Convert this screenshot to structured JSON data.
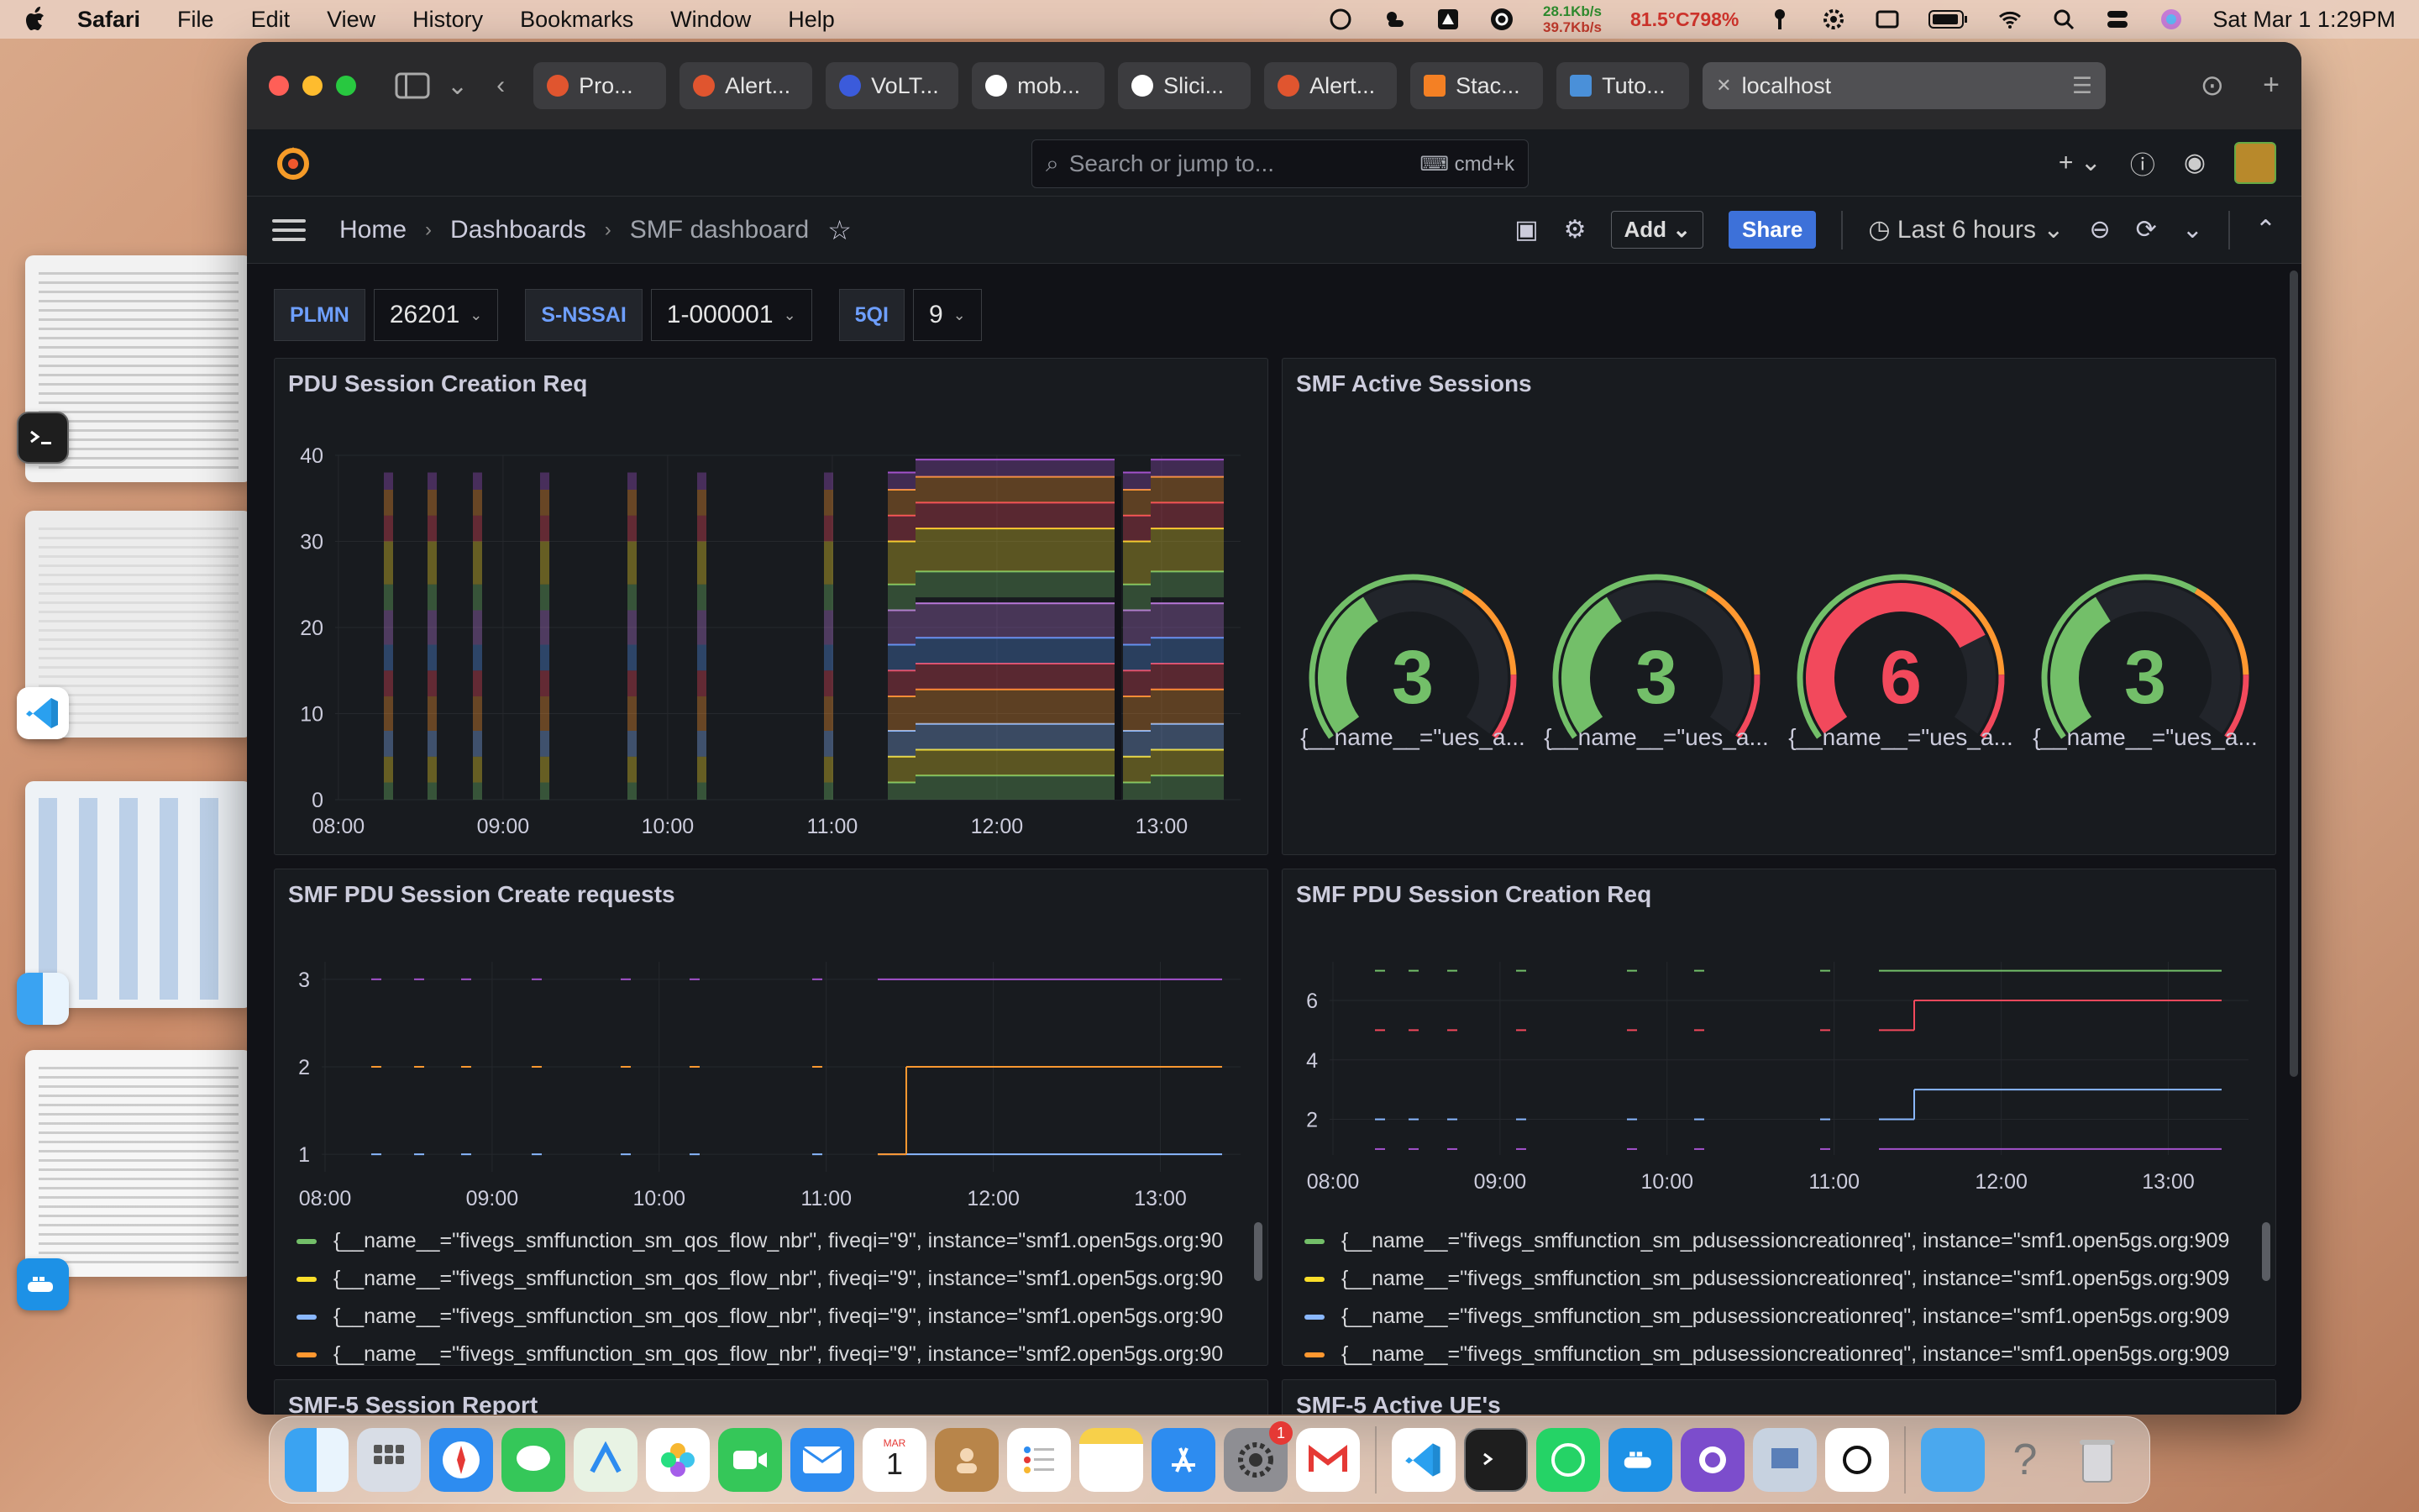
{
  "menubar": {
    "app": "Safari",
    "items": [
      "File",
      "Edit",
      "View",
      "History",
      "Bookmarks",
      "Window",
      "Help"
    ],
    "net_up": "28.1Kb/s",
    "net_down": "39.7Kb/s",
    "temp": "81.5°C798%",
    "datetime": "Sat Mar 1  1:29PM"
  },
  "tabs": [
    {
      "label": "Pro...",
      "color": "#e0552f"
    },
    {
      "label": "Alert...",
      "color": "#e0552f"
    },
    {
      "label": "VoLT...",
      "color": "#3b5bdb"
    },
    {
      "label": "mob...",
      "color": "#ffffff"
    },
    {
      "label": "Slici...",
      "color": "#ffffff"
    },
    {
      "label": "Alert...",
      "color": "#e0552f"
    },
    {
      "label": "Stac...",
      "color": "#f48024"
    },
    {
      "label": "Tuto...",
      "color": "#4a90d9"
    },
    {
      "label": "localhost",
      "color": "#cccccc"
    }
  ],
  "grafana": {
    "search_placeholder": "Search or jump to...",
    "search_kbd": "cmd+k",
    "breadcrumb": [
      "Home",
      "Dashboards",
      "SMF dashboard"
    ],
    "add_label": "Add",
    "share_label": "Share",
    "time_range": "Last 6 hours"
  },
  "variables": [
    {
      "label": "PLMN",
      "value": "26201"
    },
    {
      "label": "S-NSSAI",
      "value": "1-000001"
    },
    {
      "label": "5QI",
      "value": "9"
    }
  ],
  "panels": {
    "p1_title": "PDU Session Creation Req",
    "p2_title": "SMF Active Sessions",
    "p3_title": "SMF PDU Session Create requests",
    "p4_title": "SMF PDU Session Creation Req",
    "p5_title": "SMF-5 Session Report",
    "p6_title": "SMF-5 Active UE's"
  },
  "gauges": [
    {
      "value": "3",
      "label": "{__name__=\"ues_a...",
      "color": "#73bf69"
    },
    {
      "value": "3",
      "label": "{__name__=\"ues_a...",
      "color": "#73bf69"
    },
    {
      "value": "6",
      "label": "{__name__=\"ues_a...",
      "color": "#f2495c"
    },
    {
      "value": "3",
      "label": "{__name__=\"ues_a...",
      "color": "#73bf69"
    }
  ],
  "legend3": [
    {
      "text": "{__name__=\"fivegs_smffunction_sm_qos_flow_nbr\", fiveqi=\"9\", instance=\"smf1.open5gs.org:90",
      "color": "#73bf69"
    },
    {
      "text": "{__name__=\"fivegs_smffunction_sm_qos_flow_nbr\", fiveqi=\"9\", instance=\"smf1.open5gs.org:90",
      "color": "#fade2a"
    },
    {
      "text": "{__name__=\"fivegs_smffunction_sm_qos_flow_nbr\", fiveqi=\"9\", instance=\"smf1.open5gs.org:90",
      "color": "#8ab8ff"
    },
    {
      "text": "{__name__=\"fivegs_smffunction_sm_qos_flow_nbr\", fiveqi=\"9\", instance=\"smf2.open5gs.org:90",
      "color": "#ff9830"
    }
  ],
  "legend4": [
    {
      "text": "{__name__=\"fivegs_smffunction_sm_pdusessioncreationreq\", instance=\"smf1.open5gs.org:909",
      "color": "#73bf69"
    },
    {
      "text": "{__name__=\"fivegs_smffunction_sm_pdusessioncreationreq\", instance=\"smf1.open5gs.org:909",
      "color": "#fade2a"
    },
    {
      "text": "{__name__=\"fivegs_smffunction_sm_pdusessioncreationreq\", instance=\"smf1.open5gs.org:909",
      "color": "#8ab8ff"
    },
    {
      "text": "{__name__=\"fivegs_smffunction_sm_pdusessioncreationreq\", instance=\"smf1.open5gs.org:909",
      "color": "#ff9830"
    }
  ],
  "chart_data": [
    {
      "type": "area",
      "title": "PDU Session Creation Req",
      "x_ticks": [
        "08:00",
        "09:00",
        "10:00",
        "11:00",
        "12:00",
        "13:00"
      ],
      "y_ticks": [
        "0",
        "10",
        "20",
        "30",
        "40"
      ],
      "ylim": [
        0,
        40
      ],
      "series_stack_levels": [
        2,
        5,
        8,
        12,
        15,
        18,
        22,
        25,
        30,
        33,
        36,
        38
      ]
    },
    {
      "type": "line",
      "title": "SMF PDU Session Create requests",
      "x_ticks": [
        "08:00",
        "09:00",
        "10:00",
        "11:00",
        "12:00",
        "13:00"
      ],
      "y_ticks": [
        "1",
        "2",
        "3"
      ],
      "ylim": [
        0.8,
        3.2
      ],
      "series": [
        {
          "color": "#8ab8ff",
          "values": [
            1
          ]
        },
        {
          "color": "#ff9830",
          "values": [
            2
          ]
        },
        {
          "color": "#a352cc",
          "values": [
            3
          ]
        }
      ]
    },
    {
      "type": "line",
      "title": "SMF PDU Session Creation Req",
      "x_ticks": [
        "08:00",
        "09:00",
        "10:00",
        "11:00",
        "12:00",
        "13:00"
      ],
      "y_ticks": [
        "2",
        "4",
        "6"
      ],
      "ylim": [
        0.8,
        7.3
      ],
      "series": [
        {
          "color": "#73bf69",
          "values": [
            7
          ]
        },
        {
          "color": "#f2495c",
          "values": [
            5,
            6
          ]
        },
        {
          "color": "#8ab8ff",
          "values": [
            2,
            3
          ]
        },
        {
          "color": "#a352cc",
          "values": [
            1
          ]
        }
      ]
    }
  ]
}
